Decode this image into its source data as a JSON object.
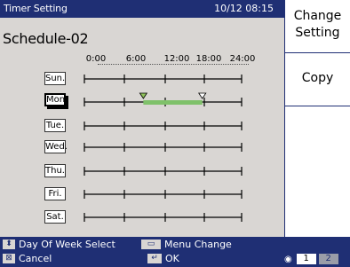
{
  "header": {
    "title": "Timer Setting",
    "datetime": "10/12 08:15"
  },
  "schedule": {
    "name": "Schedule-02",
    "time_labels": [
      "0:00",
      "6:00",
      "12:00",
      "18:00",
      "24:00"
    ],
    "days": [
      {
        "label": "Sun.",
        "selected": false,
        "on_range": null
      },
      {
        "label": "Mon.",
        "selected": true,
        "on_range": [
          9,
          18
        ]
      },
      {
        "label": "Tue.",
        "selected": false,
        "on_range": null
      },
      {
        "label": "Wed.",
        "selected": false,
        "on_range": null
      },
      {
        "label": "Thu.",
        "selected": false,
        "on_range": null
      },
      {
        "label": "Fri.",
        "selected": false,
        "on_range": null
      },
      {
        "label": "Sat.",
        "selected": false,
        "on_range": null
      }
    ],
    "on_color": "#7fc16a"
  },
  "side_buttons": {
    "change_setting": [
      "Change",
      "Setting"
    ],
    "copy": "Copy"
  },
  "footer": {
    "day_select": "Day Of Week Select",
    "menu_change": "Menu Change",
    "cancel": "Cancel",
    "ok": "OK",
    "pages": [
      "1",
      "2"
    ],
    "current_page": "1"
  },
  "colors": {
    "bar": "#1f2f74",
    "panel": "#d9d6d3"
  }
}
